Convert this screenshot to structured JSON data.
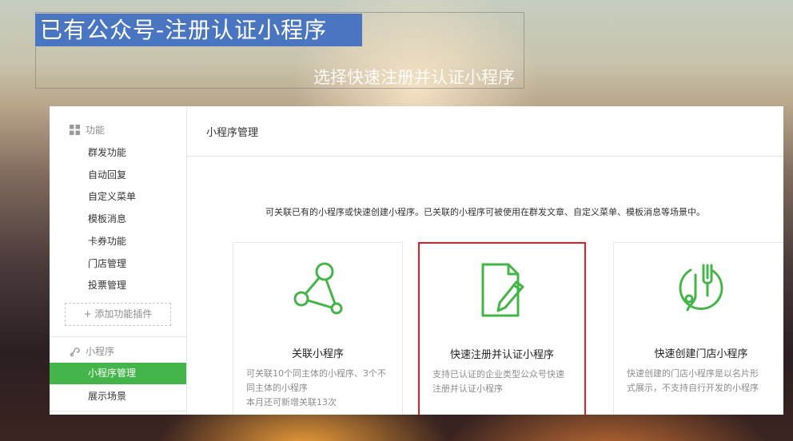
{
  "slide": {
    "title": "已有公众号-注册认证小程序",
    "subtitle": "选择快速注册并认证小程序",
    "accent_color": "#4a76c1"
  },
  "sidebar": {
    "section_features": {
      "icon": "grid-icon",
      "label": "功能"
    },
    "feature_items": [
      {
        "label": "群发功能"
      },
      {
        "label": "自动回复"
      },
      {
        "label": "自定义菜单"
      },
      {
        "label": "模板消息"
      },
      {
        "label": "卡券功能"
      },
      {
        "label": "门店管理"
      },
      {
        "label": "投票管理"
      }
    ],
    "add_plugin_label": "+ 添加功能插件",
    "section_miniprogram": {
      "icon": "miniprogram-icon",
      "label": "小程序"
    },
    "miniprogram_items": [
      {
        "label": "小程序管理",
        "active": true
      },
      {
        "label": "展示场景",
        "active": false
      }
    ],
    "active_color": "#44b549"
  },
  "main": {
    "title": "小程序管理",
    "description": "可关联已有的小程序或快速创建小程序。已关联的小程序可被使用在群发文章、自定义菜单、模板消息等场景中。",
    "cards": [
      {
        "icon": "link-nodes-icon",
        "title": "关联小程序",
        "desc_lines": [
          "可关联10个同主体的小程序、3个不",
          "同主体的小程序",
          "本月还可新增关联13次"
        ]
      },
      {
        "icon": "register-doc-icon",
        "title": "快速注册并认证小程序",
        "desc_lines": [
          "支持已认证的企业类型公众号快速",
          "注册并认证小程序"
        ],
        "highlighted": true
      },
      {
        "icon": "store-fork-icon",
        "title": "快速创建门店小程序",
        "desc_lines": [
          "快速创建的门店小程序是以名片形",
          "式展示，不支持自行开发的小程序"
        ]
      }
    ],
    "icon_color": "#44b549",
    "highlight_color": "#e02020"
  }
}
